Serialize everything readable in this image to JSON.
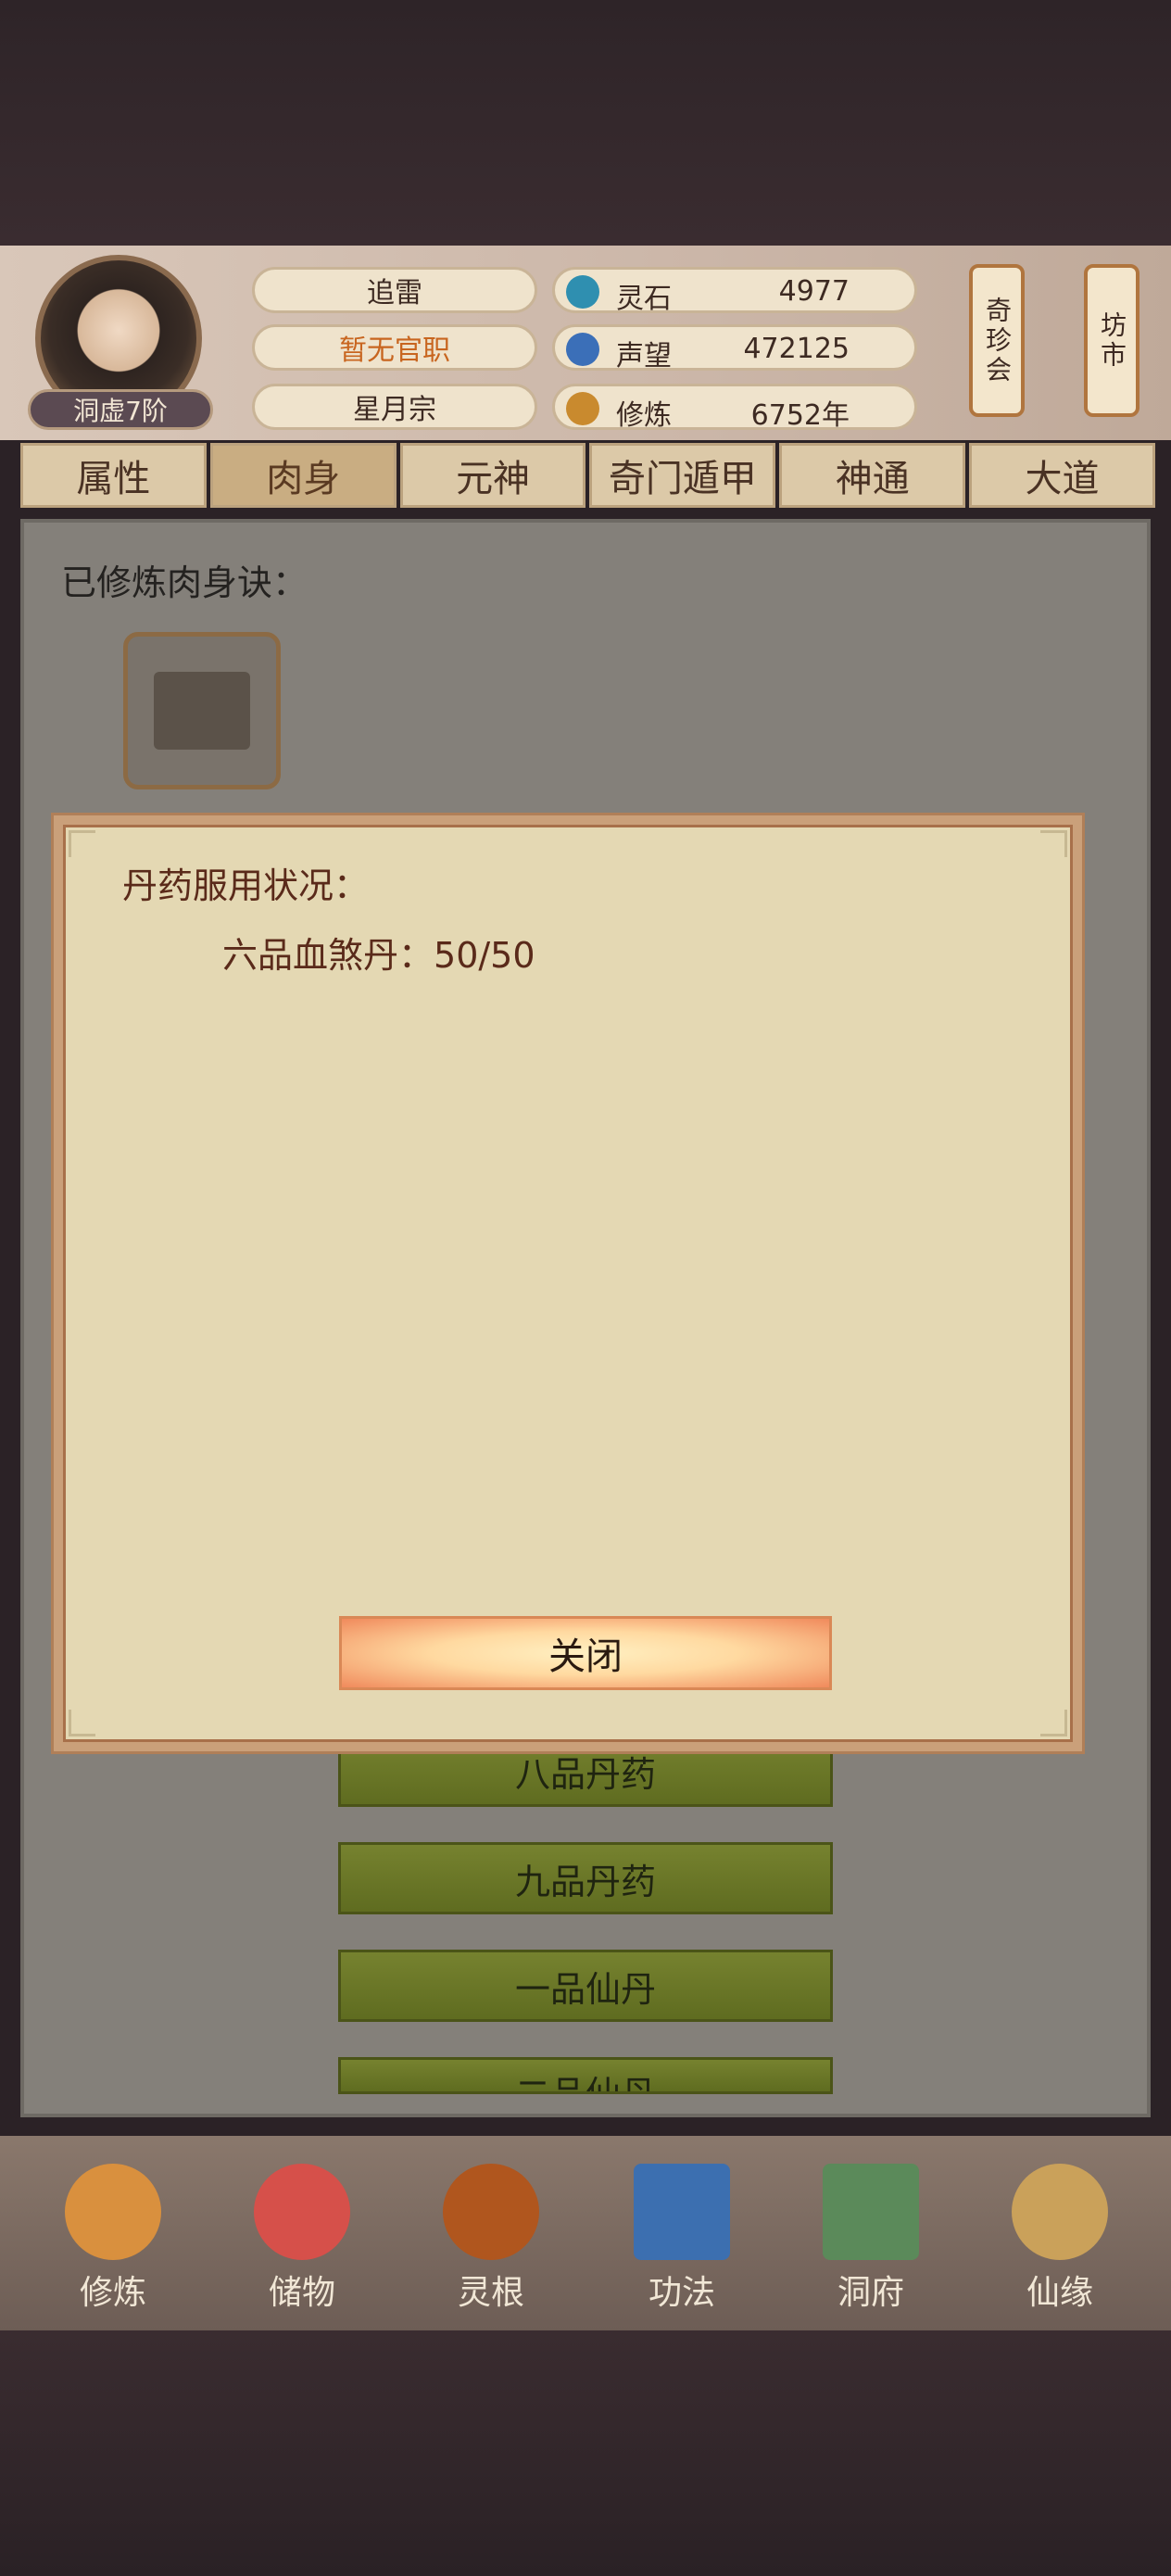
{
  "header": {
    "rank_badge": "洞虚7阶",
    "name": "追雷",
    "official_title": "暂无官职",
    "sect": "星月宗",
    "stats": [
      {
        "label": "灵石",
        "value": "4977",
        "icon": "spirit-stone-icon"
      },
      {
        "label": "声望",
        "value": "472125",
        "icon": "reputation-icon"
      },
      {
        "label": "修炼",
        "value": "6752年",
        "icon": "cultivation-icon"
      }
    ],
    "scroll_buttons": [
      "奇珍会",
      "坊市"
    ]
  },
  "tabs": [
    "属性",
    "肉身",
    "元神",
    "奇门遁甲",
    "神通",
    "大道"
  ],
  "active_tab": "肉身",
  "panel": {
    "cultivated_label": "已修炼肉身诀：",
    "pill_buttons": [
      "八品丹药",
      "九品丹药",
      "一品仙丹",
      "二品仙丹"
    ]
  },
  "modal": {
    "title": "丹药服用状况：",
    "row_name": "六品血煞丹：",
    "row_value": "50/50",
    "close_label": "关闭"
  },
  "nav": [
    "修炼",
    "储物",
    "灵根",
    "功法",
    "洞府",
    "仙缘"
  ],
  "colors": {
    "modal_bg": "#e4d8b3",
    "modal_text": "#5a2a1a",
    "official_orange": "#c8651f",
    "green_button": "#6b7828"
  }
}
